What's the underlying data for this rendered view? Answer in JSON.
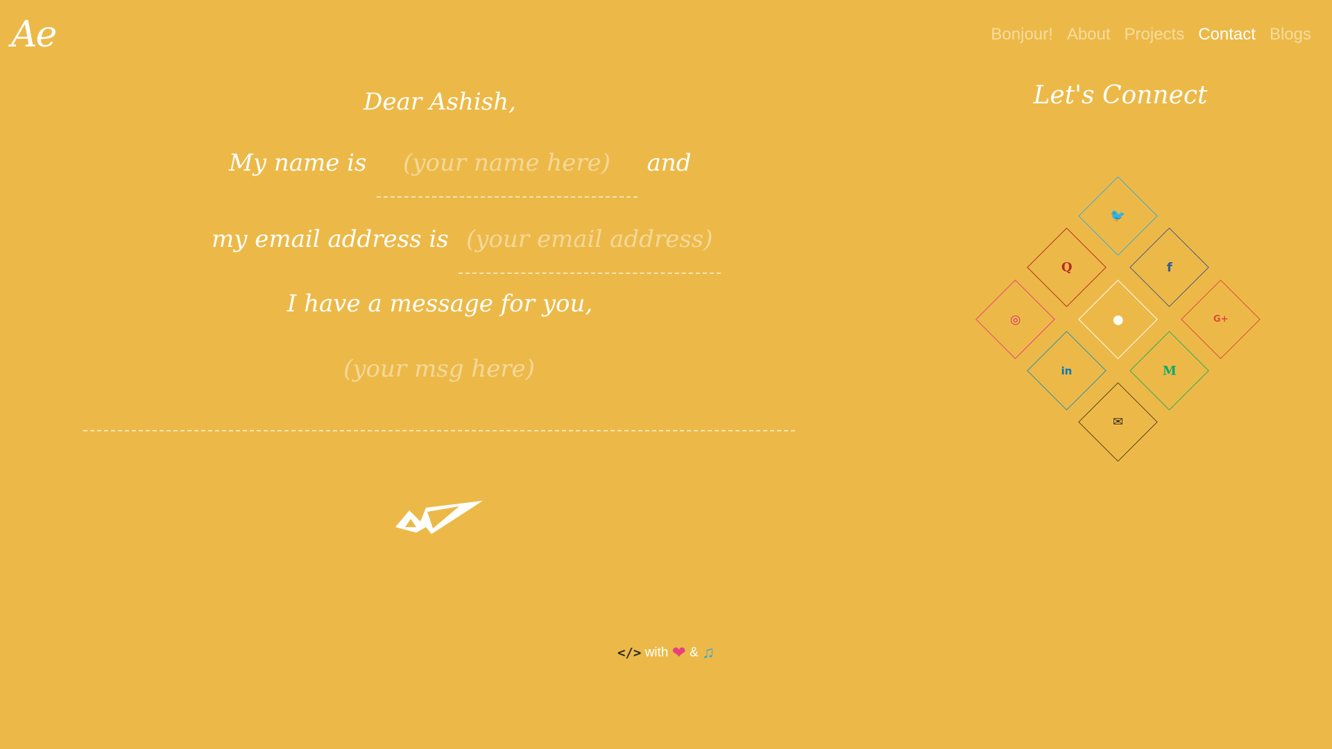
{
  "header": {
    "logo": "Ae",
    "nav": [
      {
        "label": "Bonjour!",
        "active": false
      },
      {
        "label": "About",
        "active": false
      },
      {
        "label": "Projects",
        "active": false
      },
      {
        "label": "Contact",
        "active": true
      },
      {
        "label": "Blogs",
        "active": false
      }
    ]
  },
  "form": {
    "greeting": "Dear Ashish,",
    "name_prefix": "My name is",
    "name_placeholder": "(your name here)",
    "name_suffix": "and",
    "email_prefix": "my email address is",
    "email_placeholder": "(your email address)",
    "message_label": "I have a message for you,",
    "message_placeholder": "(your msg here)",
    "send_icon": "paper-plane-icon"
  },
  "connect": {
    "title": "Let's Connect",
    "links": [
      {
        "name": "twitter",
        "glyph": "🐦",
        "color": "#1da1f2"
      },
      {
        "name": "quora",
        "glyph": "Q",
        "color": "#b92b27"
      },
      {
        "name": "facebook",
        "glyph": "f",
        "color": "#3b5998"
      },
      {
        "name": "instagram",
        "glyph": "◎",
        "color": "#e1306c"
      },
      {
        "name": "github",
        "glyph": "●",
        "color": "#ffffff"
      },
      {
        "name": "google-plus",
        "glyph": "G+",
        "color": "#dd4b39"
      },
      {
        "name": "linkedin",
        "glyph": "in",
        "color": "#0077b5"
      },
      {
        "name": "medium",
        "glyph": "M",
        "color": "#00ab6c"
      },
      {
        "name": "email",
        "glyph": "✉",
        "color": "#3d2b1f"
      }
    ]
  },
  "footer": {
    "code_symbol": "</>",
    "with_text": "with",
    "heart": "❤",
    "and_text": "&",
    "music": "♫"
  }
}
